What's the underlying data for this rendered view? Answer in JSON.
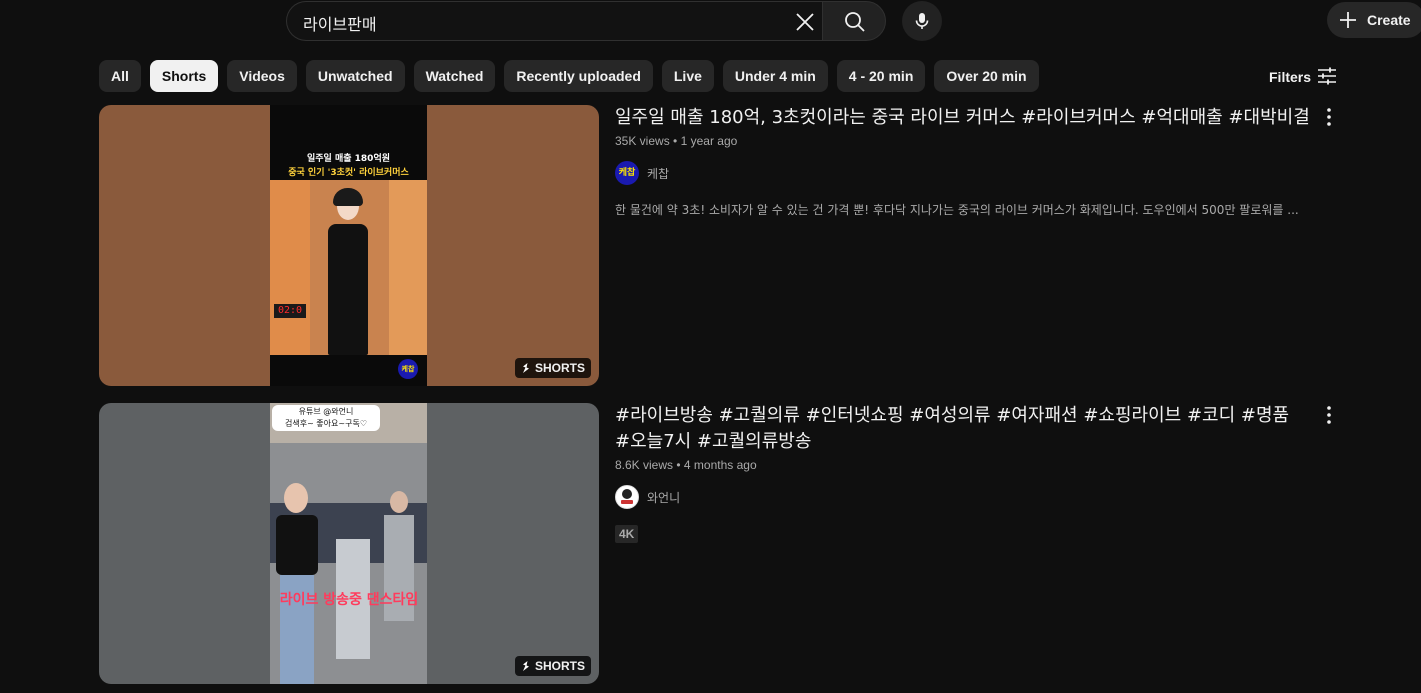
{
  "search": {
    "query": "라이브판매"
  },
  "header": {
    "create_label": "Create"
  },
  "chips": [
    "All",
    "Shorts",
    "Videos",
    "Unwatched",
    "Watched",
    "Recently uploaded",
    "Live",
    "Under 4 min",
    "4 - 20 min",
    "Over 20 min"
  ],
  "active_chip": "Shorts",
  "filters_label": "Filters",
  "results": [
    {
      "title": "일주일 매출 180억, 3초컷이라는 중국 라이브 커머스 #라이브커머스 #억대매출 #대박비결",
      "views": "35K views",
      "age": "1 year ago",
      "channel": "케찹",
      "channel_avatar_text": "케찹",
      "description": "한 물건에 약 3초! 소비자가 알 수 있는 건 가격 뿐! 후다닥 지나가는 중국의 라이브 커머스가 화제입니다. 도우인에서 500만 팔로워를 ...",
      "badge": "SHORTS",
      "thumb_text_1": "일주일 매출 180억원",
      "thumb_text_2": "중국 인기 '3초컷' 라이브커머스",
      "thumb_timer": "02:0",
      "thumb_logo": "케찹",
      "thumb_bg": "#8a5a3c"
    },
    {
      "title": "#라이브방송 #고퀄의류 #인터넷쇼핑 #여성의류 #여자패션 #쇼핑라이브 #코디 #명품 #오늘7시 #고퀄의류방송",
      "views": "8.6K views",
      "age": "4 months ago",
      "channel": "와언니",
      "tag": "4K",
      "badge": "SHORTS",
      "thumb_text_1": "유튜브 @와언니",
      "thumb_text_2": "검색후~ 좋아요~구독♡",
      "thumb_text_3": "라이브 방송중 댄스타임",
      "thumb_bg": "#5e6163"
    }
  ],
  "colors": {
    "background": "#0f0f0f",
    "chip_bg": "#272727",
    "chip_active_bg": "#f1f1f1",
    "text_primary": "#f1f1f1",
    "text_secondary": "#aaaaaa"
  }
}
